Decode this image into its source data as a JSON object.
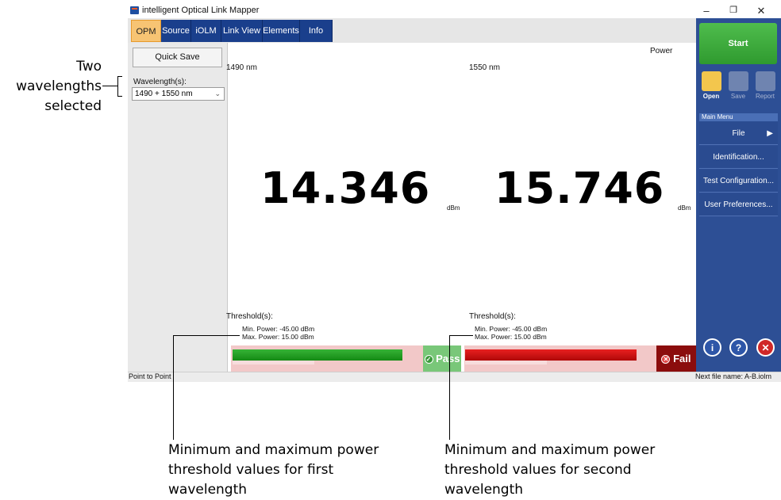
{
  "window": {
    "title": "intelligent Optical Link Mapper",
    "controls": {
      "minimize": "–",
      "restore": "❐",
      "close": "✕"
    }
  },
  "tabs": [
    {
      "label": "OPM",
      "active": true
    },
    {
      "label": "Source"
    },
    {
      "label": "iOLM"
    },
    {
      "label": "Link View"
    },
    {
      "label": "Elements"
    },
    {
      "label": "Info"
    }
  ],
  "left_panel": {
    "quick_save_label": "Quick Save",
    "wavelength_label": "Wavelength(s):",
    "wavelength_value": "1490 + 1550 nm"
  },
  "main": {
    "power_label": "Power",
    "channels": [
      {
        "wavelength": "1490 nm",
        "value": "14.346",
        "unit": "dBm",
        "threshold_title": "Threshold(s):",
        "min_power": "Min. Power: -45.00 dBm",
        "max_power": "Max. Power: 15.00 dBm",
        "status": "Pass",
        "status_color": "#74c174",
        "bar_color": "#1e9a1e"
      },
      {
        "wavelength": "1550 nm",
        "value": "15.746",
        "unit": "dBm",
        "threshold_title": "Threshold(s):",
        "min_power": "Min. Power: -45.00 dBm",
        "max_power": "Max. Power: 15.00 dBm",
        "status": "Fail",
        "status_color": "#8b0d0d",
        "bar_color": "#d01010"
      }
    ]
  },
  "right_panel": {
    "start_label": "Start",
    "tools": {
      "open": "Open",
      "save": "Save",
      "report": "Report"
    },
    "main_menu_label": "Main Menu",
    "menu_items": [
      "File",
      "Identification...",
      "Test Configuration...",
      "User Preferences..."
    ],
    "file_arrow": "▶",
    "accent": "#2d4f95"
  },
  "status_bar": {
    "left": "Point to Point",
    "right": "Next file name: A-B.iolm"
  },
  "annotations": {
    "left_line1": "Two",
    "left_line2": "wavelengths",
    "left_line3": "selected",
    "bottom_left": [
      "Minimum and maximum power",
      "threshold values for first",
      "wavelength"
    ],
    "bottom_right": [
      "Minimum and maximum power",
      "threshold values for second",
      "wavelength"
    ]
  }
}
